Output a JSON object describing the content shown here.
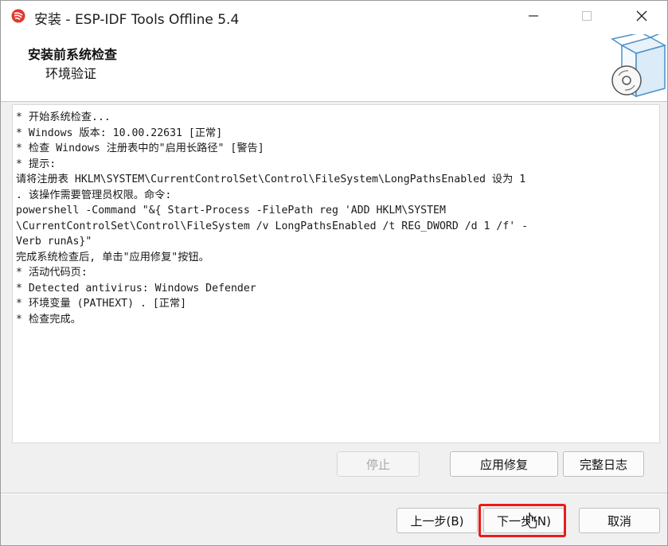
{
  "window": {
    "title": "安装 - ESP-IDF Tools Offline 5.4",
    "icons": {
      "app": "espressif-logo-icon",
      "minimize": "minimize-icon",
      "maximize": "maximize-icon",
      "close": "close-icon"
    }
  },
  "header": {
    "title": "安装前系统检查",
    "subtitle": "环境验证",
    "icon": "software-box-cd-icon"
  },
  "log": {
    "lines": [
      "* 开始系统检查...",
      "* Windows 版本: 10.00.22631 [正常]",
      "* 检查 Windows 注册表中的\"启用长路径\" [警告]",
      "* 提示:",
      "请将注册表 HKLM\\SYSTEM\\CurrentControlSet\\Control\\FileSystem\\LongPathsEnabled 设为 1",
      ". 该操作需要管理员权限。命令:",
      "powershell -Command \"&{ Start-Process -FilePath reg 'ADD HKLM\\SYSTEM",
      "\\CurrentControlSet\\Control\\FileSystem /v LongPathsEnabled /t REG_DWORD /d 1 /f' -",
      "Verb runAs}\"",
      "完成系统检查后, 单击\"应用修复\"按钮。",
      "* 活动代码页:",
      "* Detected antivirus: Windows Defender",
      "* 环境变量 (PATHEXT) . [正常]",
      "* 检查完成。"
    ]
  },
  "actions": {
    "stop": "停止",
    "apply_fix": "应用修复",
    "full_log": "完整日志"
  },
  "nav": {
    "back": "上一步(B)",
    "next": "下一步(N)",
    "cancel": "取消"
  },
  "colors": {
    "highlight": "#e81c1c",
    "window_bg": "#f0f0f0",
    "espressif_red": "#e03a2f",
    "box_blue": "#4a90c8"
  }
}
